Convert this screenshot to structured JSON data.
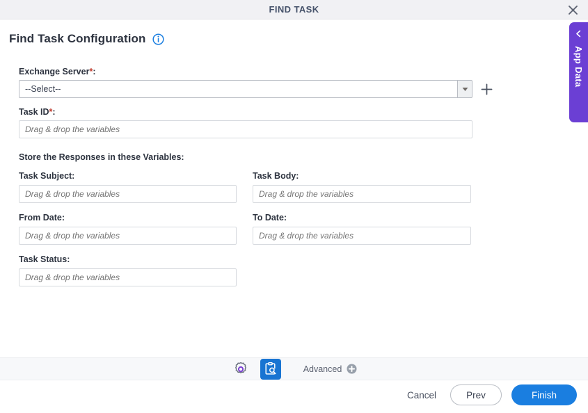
{
  "window": {
    "title": "FIND TASK",
    "close_icon": "close-icon"
  },
  "heading": {
    "title": "Find Task Configuration",
    "info_icon": "info-icon"
  },
  "app_data_tab": {
    "label": "App Data",
    "chevron_icon": "chevron-left-icon",
    "color": "#6b3fd4"
  },
  "form": {
    "exchange_server": {
      "label": "Exchange Server",
      "required_marker": "*",
      "colon": ":",
      "selected_value": "--Select--",
      "dropdown_icon": "chevron-down-icon",
      "add_icon": "plus-icon"
    },
    "task_id": {
      "label": "Task ID",
      "required_marker": "*",
      "colon": ":",
      "value": "",
      "placeholder": "Drag & drop the variables"
    },
    "store_section_title": "Store the Responses in these Variables:",
    "task_subject": {
      "label": "Task Subject:",
      "value": "",
      "placeholder": "Drag & drop the variables"
    },
    "task_body": {
      "label": "Task Body:",
      "value": "",
      "placeholder": "Drag & drop the variables"
    },
    "from_date": {
      "label": "From Date:",
      "value": "",
      "placeholder": "Drag & drop the variables"
    },
    "to_date": {
      "label": "To Date:",
      "value": "",
      "placeholder": "Drag & drop the variables"
    },
    "task_status": {
      "label": "Task Status:",
      "value": "",
      "placeholder": "Drag & drop the variables"
    }
  },
  "toolbar": {
    "settings_icon": "gear-icon",
    "find_task_icon": "clipboard-search-icon",
    "advanced_label": "Advanced",
    "advanced_add_icon": "plus-circle-icon",
    "active_color": "#1874d2"
  },
  "footer": {
    "cancel_label": "Cancel",
    "prev_label": "Prev",
    "finish_label": "Finish",
    "finish_color": "#1a7ee0"
  }
}
